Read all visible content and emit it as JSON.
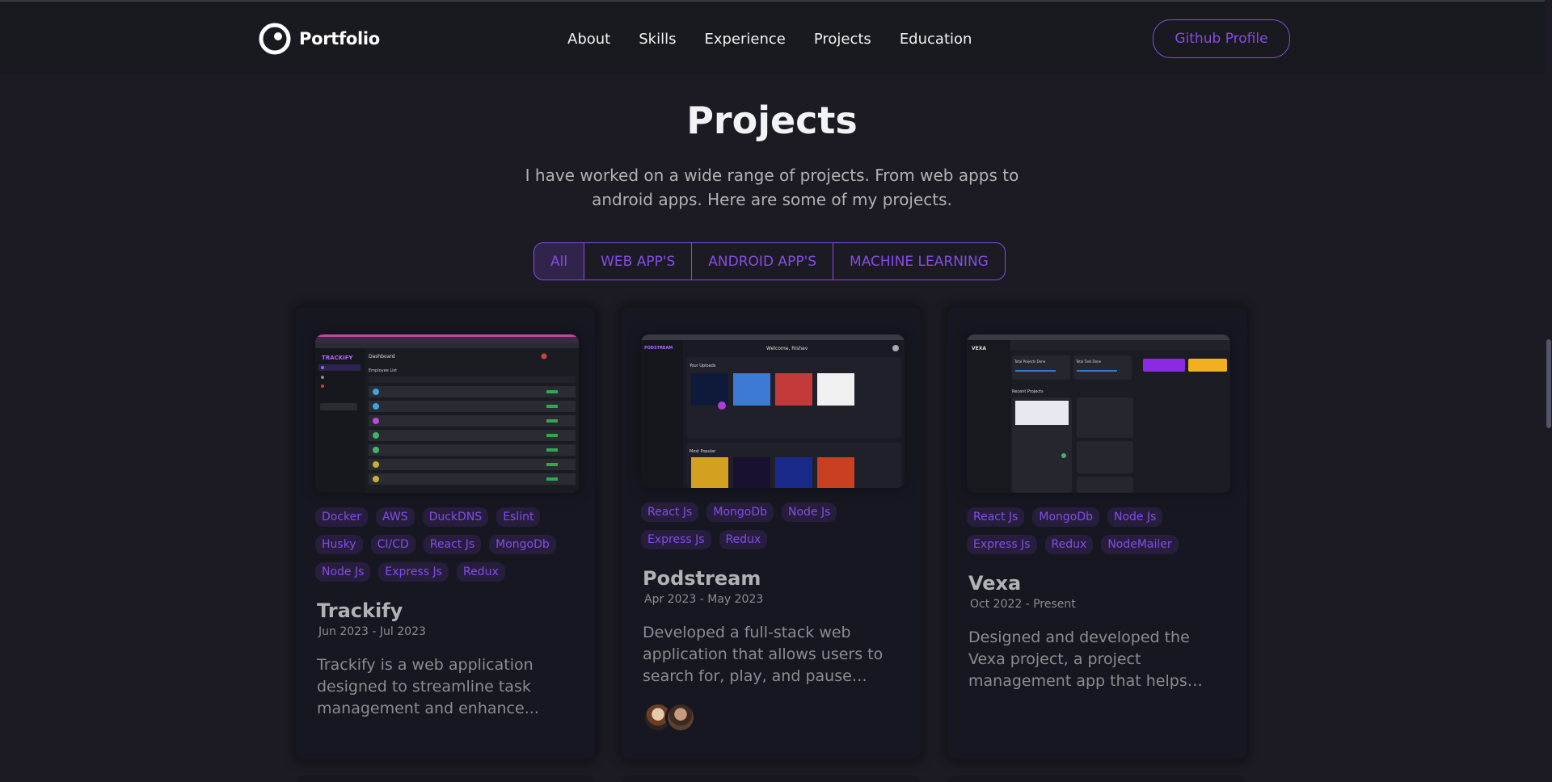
{
  "nav": {
    "logo_text": "Portfolio",
    "links": [
      "About",
      "Skills",
      "Experience",
      "Projects",
      "Education"
    ],
    "github_label": "Github Profile"
  },
  "section": {
    "title": "Projects",
    "description": "I have worked on a wide range of projects. From web apps to android apps. Here are some of my projects."
  },
  "filters": [
    "All",
    "WEB APP'S",
    "ANDROID APP'S",
    "MACHINE LEARNING"
  ],
  "projects": [
    {
      "tags": [
        "Docker",
        "AWS",
        "DuckDNS",
        "Eslint",
        "Husky",
        "CI/CD",
        "React Js",
        "MongoDb",
        "Node Js",
        "Express Js",
        "Redux"
      ],
      "title": "Trackify",
      "date": "Jun 2023 - Jul 2023",
      "description": "Trackify is a web application designed to streamline task management and enhance...",
      "shot": {
        "brand": "TRACKIFY",
        "heading": "Dashboard",
        "subheading": "Employee List"
      }
    },
    {
      "tags": [
        "React Js",
        "MongoDb",
        "Node Js",
        "Express Js",
        "Redux"
      ],
      "title": "Podstream",
      "date": "Apr 2023 - May 2023",
      "description": "Developed a full-stack web application that allows users to search for, play, and pause their...",
      "shot": {
        "brand": "PODSTREAM",
        "heading": "Welcome, Rishav",
        "subheading": "Your Uploads",
        "subheading2": "Most Popular"
      }
    },
    {
      "tags": [
        "React Js",
        "MongoDb",
        "Node Js",
        "Express Js",
        "Redux",
        "NodeMailer"
      ],
      "title": "Vexa",
      "date": "Oct 2022 - Present",
      "description": "Designed and developed the Vexa project, a project management app that helps users and teams...",
      "shot": {
        "brand": "VEXA",
        "heading": "Total Projects Done",
        "heading2": "Total Task Done",
        "subheading": "Recent Projects"
      }
    }
  ],
  "colors": {
    "accent": "#854ce6",
    "background": "#1c1b23",
    "card": "#171721",
    "text_primary": "#f2f3f4",
    "text_secondary": "#b1b2b3"
  }
}
